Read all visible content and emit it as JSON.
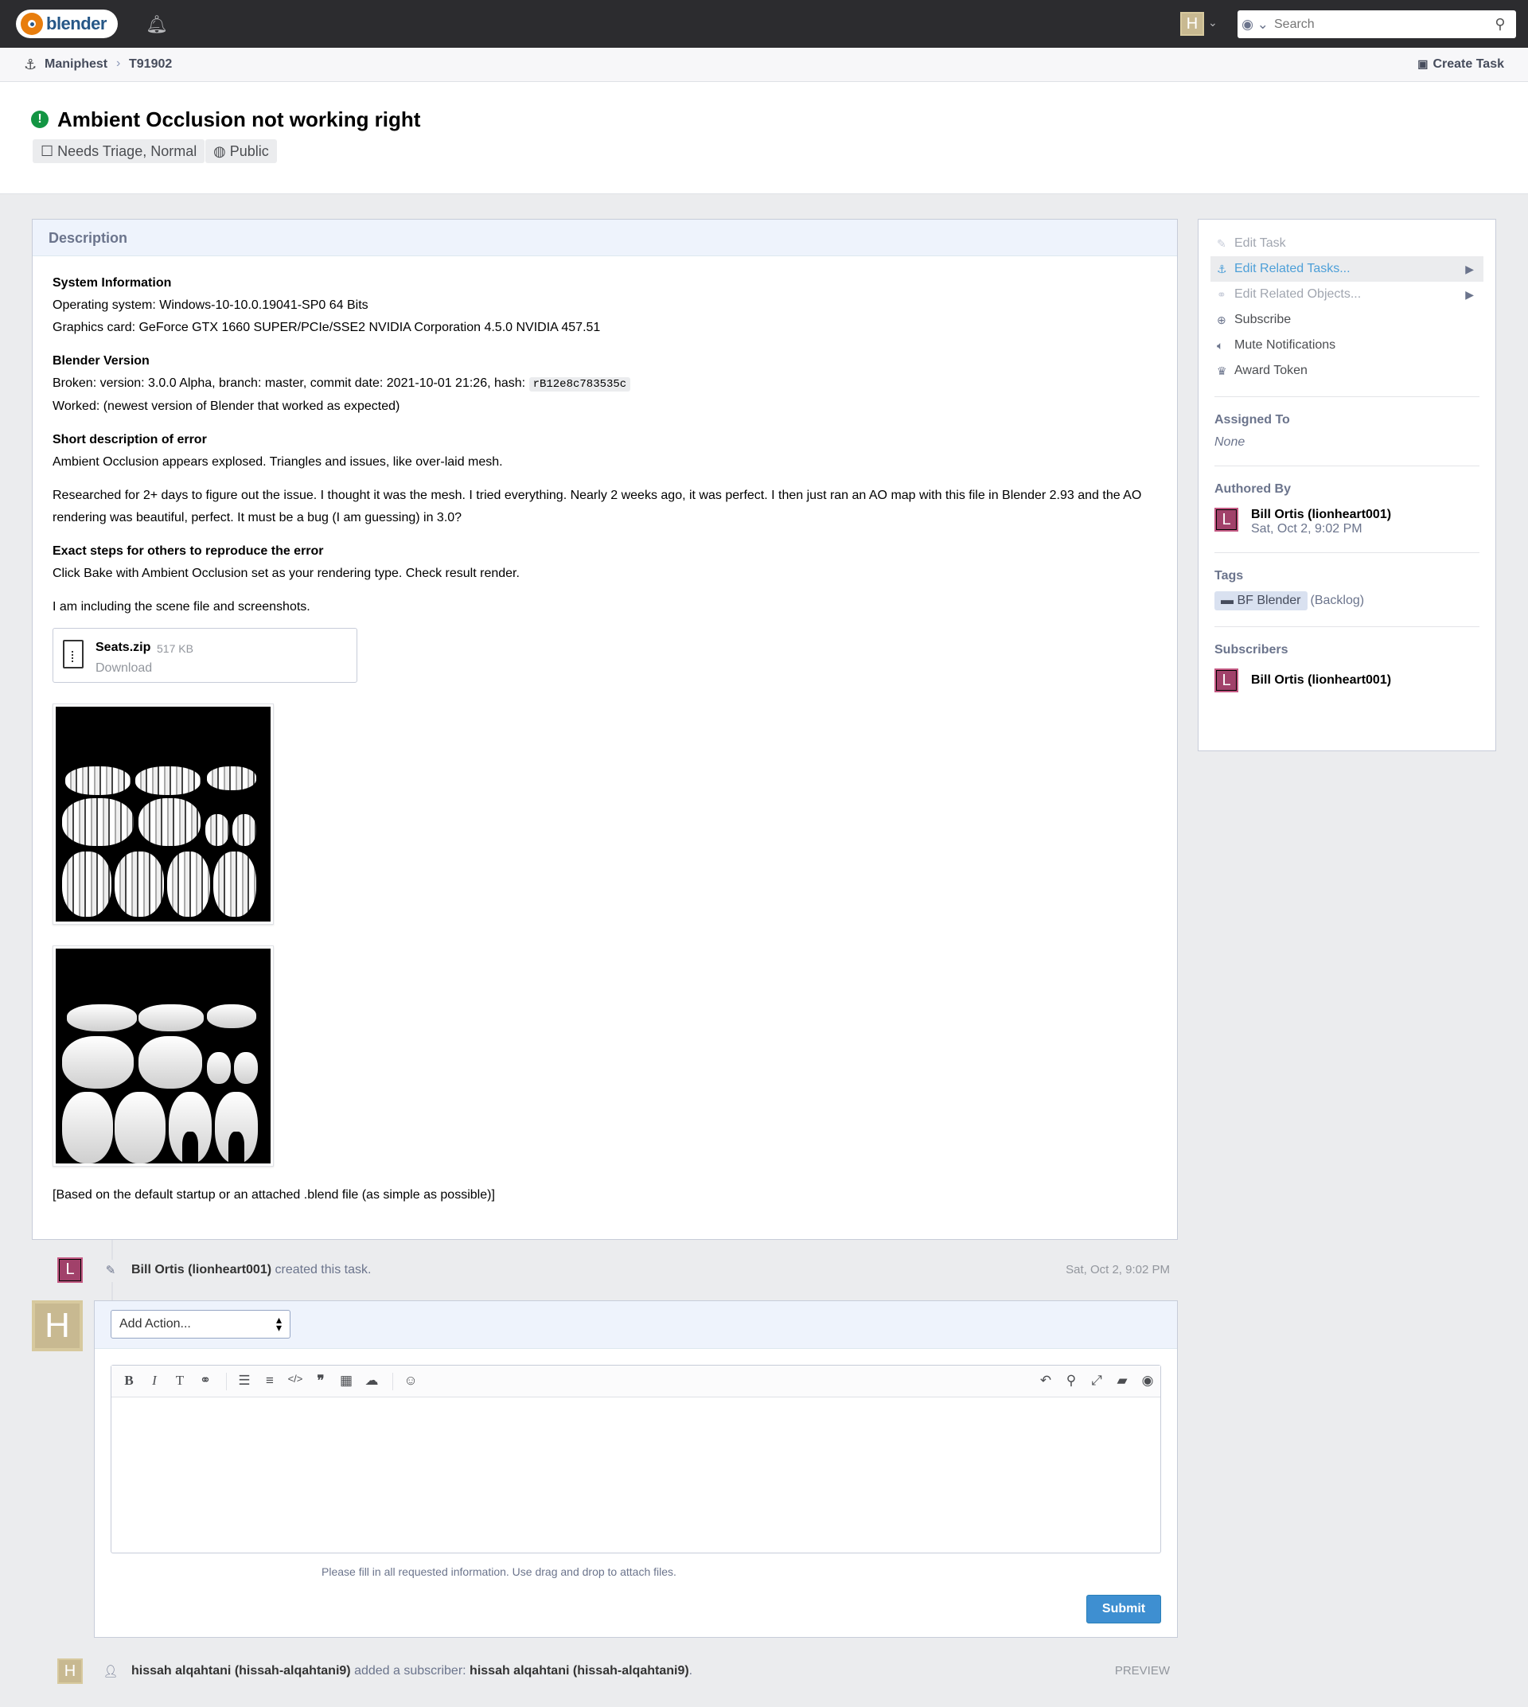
{
  "topbar": {
    "logo_text": "blender",
    "search_placeholder": "Search",
    "user_initial": "H"
  },
  "breadcrumb": {
    "app": "Maniphest",
    "task": "T91902",
    "create_task": "Create Task"
  },
  "header": {
    "title": "Ambient Occlusion not working right",
    "status": "Needs Triage, Normal",
    "visibility": "Public"
  },
  "description": {
    "heading": "Description",
    "sys_info_title": "System Information",
    "os": "Operating system: Windows-10-10.0.19041-SP0 64 Bits",
    "gpu": "Graphics card: GeForce GTX 1660 SUPER/PCIe/SSE2 NVIDIA Corporation 4.5.0 NVIDIA 457.51",
    "version_title": "Blender Version",
    "broken_prefix": "Broken: version: 3.0.0 Alpha, branch: master, commit date: 2021-10-01 21:26, hash: ",
    "hash": "rB12e8c783535c",
    "worked": "Worked: (newest version of Blender that worked as expected)",
    "short_title": "Short description of error",
    "short_text": "Ambient Occlusion appears explosed. Triangles and issues, like over-laid mesh.",
    "research": "Researched for 2+ days to figure out the issue. I thought it was the mesh. I tried everything. Nearly 2 weeks ago, it was perfect. I then just ran an AO map with this file in Blender 2.93 and the AO rendering was beautiful, perfect. It must be a bug (I am guessing) in 3.0?",
    "steps_title": "Exact steps for others to reproduce the error",
    "steps_text": "Click Bake with Ambient Occlusion set as your rendering type. Check result render.",
    "including": "I am including the scene file and screenshots.",
    "file_name": "Seats.zip",
    "file_size": "517 KB",
    "file_download": "Download",
    "footer_note": "[Based on the default startup or an attached .blend file (as simple as possible)]"
  },
  "sidebar": {
    "actions": [
      {
        "label": "Edit Task",
        "icon": "pencil-icon"
      },
      {
        "label": "Edit Related Tasks...",
        "icon": "anchor-icon"
      },
      {
        "label": "Edit Related Objects...",
        "icon": "link-icon"
      },
      {
        "label": "Subscribe",
        "icon": "plus-circle-icon"
      },
      {
        "label": "Mute Notifications",
        "icon": "volume-icon"
      },
      {
        "label": "Award Token",
        "icon": "trophy-icon"
      }
    ],
    "assigned_label": "Assigned To",
    "assigned_value": "None",
    "authored_label": "Authored By",
    "author_name": "Bill Ortis (lionheart001)",
    "author_date": "Sat, Oct 2, 9:02 PM",
    "tags_label": "Tags",
    "tag_project": "BF Blender",
    "tag_column": "(Backlog)",
    "subscribers_label": "Subscribers",
    "subscriber_name": "Bill Ortis (lionheart001)",
    "avatar_initial": "L"
  },
  "timeline": {
    "created_author": "Bill Ortis (lionheart001)",
    "created_text": " created this task.",
    "created_date": "Sat, Oct 2, 9:02 PM"
  },
  "comment_form": {
    "action_select": "Add Action...",
    "help_text": "Please fill in all requested information. Use drag and drop to attach files.",
    "submit": "Submit",
    "user_initial": "H"
  },
  "preview": {
    "actor": "hissah alqahtani (hissah-alqahtani9)",
    "verb": " added a subscriber: ",
    "target": "hissah alqahtani (hissah-alqahtani9)",
    "suffix": ".",
    "tag": "PREVIEW"
  },
  "colors": {
    "accent": "#3e8fd1",
    "status_green": "#139543",
    "avatar_L": "#a1416a",
    "avatar_H": "#c8b991"
  }
}
